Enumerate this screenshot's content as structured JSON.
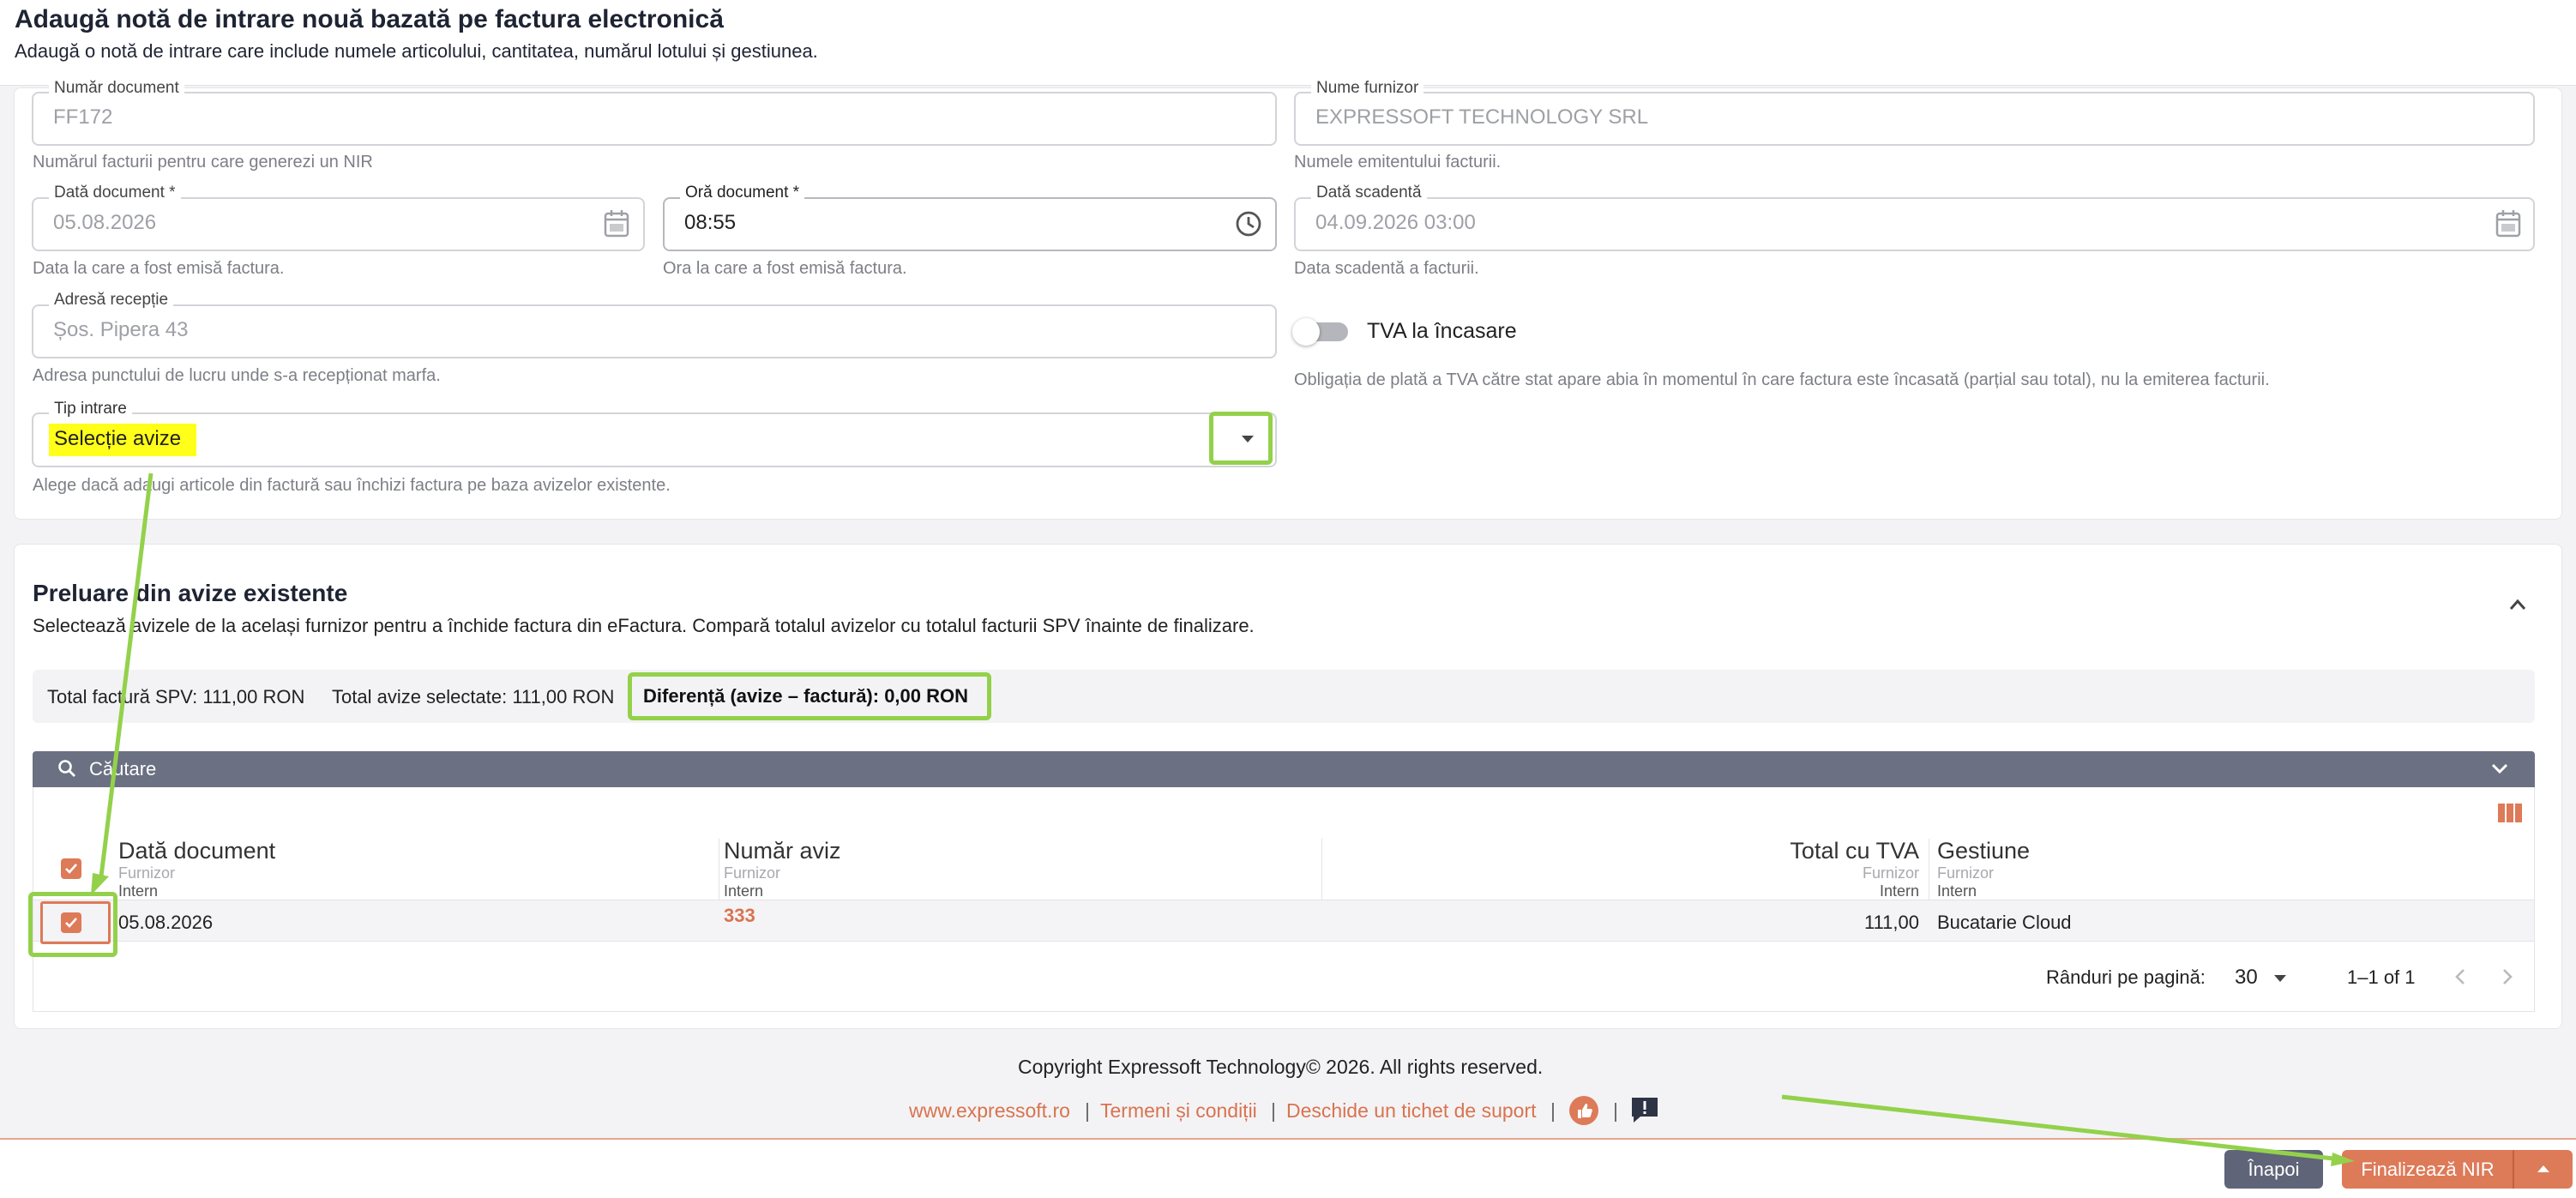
{
  "header": {
    "title": "Adaugă notă de intrare nouă bazată pe factura electronică",
    "subtitle": "Adaugă o notă de intrare care include numele articolului, cantitatea, numărul lotului și gestiunea."
  },
  "form": {
    "doc_number": {
      "label": "Număr document",
      "value": "FF172",
      "hint": "Numărul facturii pentru care generezi un NIR"
    },
    "supplier": {
      "label": "Nume furnizor",
      "value": "EXPRESSOFT TECHNOLOGY SRL",
      "hint": "Numele emitentului facturii."
    },
    "doc_date": {
      "label": "Dată document *",
      "value": "05.08.2026",
      "hint": "Data la care a fost emisă factura."
    },
    "doc_time": {
      "label": "Oră document *",
      "value": "08:55",
      "hint": "Ora la care a fost emisă factura."
    },
    "due_date": {
      "label": "Dată scadentă",
      "value": "04.09.2026 03:00",
      "hint": "Data scadentă a facturii."
    },
    "address": {
      "label": "Adresă recepție",
      "value": "Șos. Pipera 43",
      "hint": "Adresa punctului de lucru unde s-a recepționat marfa."
    },
    "vat": {
      "label": "TVA la încasare",
      "on": false,
      "hint": "Obligația de plată a TVA către stat apare abia în momentul în care factura este încasată (parțial sau total), nu la emiterea facturii."
    },
    "entry_type": {
      "label": "Tip intrare",
      "value": "Selecție avize",
      "hint": "Alege dacă adaugi articole din factură sau închizi factura pe baza avizelor existente."
    }
  },
  "avize": {
    "title": "Preluare din avize existente",
    "subtitle": "Selectează avizele de la același furnizor pentru a închide factura din eFactura. Compară totalul avizelor cu totalul facturii SPV înainte de finalizare.",
    "total_spv": "Total factură SPV: 111,00 RON",
    "total_selected": "Total avize selectate: 111,00 RON",
    "difference": "Diferență (avize – factură): 0,00 RON",
    "search_label": "Căutare",
    "columns": {
      "date": {
        "label": "Dată document",
        "sub1": "Furnizor",
        "sub2": "Intern"
      },
      "number": {
        "label": "Număr aviz",
        "sub1": "Furnizor",
        "sub2": "Intern"
      },
      "total": {
        "label": "Total cu TVA",
        "sub1": "Furnizor",
        "sub2": "Intern"
      },
      "warehouse": {
        "label": "Gestiune",
        "sub1": "Furnizor",
        "sub2": "Intern"
      }
    },
    "rows": [
      {
        "date": "05.08.2026",
        "number": "333",
        "total": "111,00",
        "warehouse": "Bucatarie Cloud",
        "selected": true
      }
    ],
    "pagination": {
      "rows_per_page_label": "Rânduri pe pagină:",
      "rows_per_page": "30",
      "range": "1–1 of 1"
    }
  },
  "footer": {
    "copyright": "Copyright Expressoft Technology© 2026. All rights reserved.",
    "links": [
      "www.expressoft.ro",
      "Termeni și condiții",
      "Deschide un tichet de suport"
    ]
  },
  "actions": {
    "back": "Înapoi",
    "finalize": "Finalizează NIR"
  },
  "colors": {
    "accent": "#d9734f",
    "highlight": "#93d14b",
    "dark": "#3a3f55",
    "bar": "#6b7082"
  }
}
